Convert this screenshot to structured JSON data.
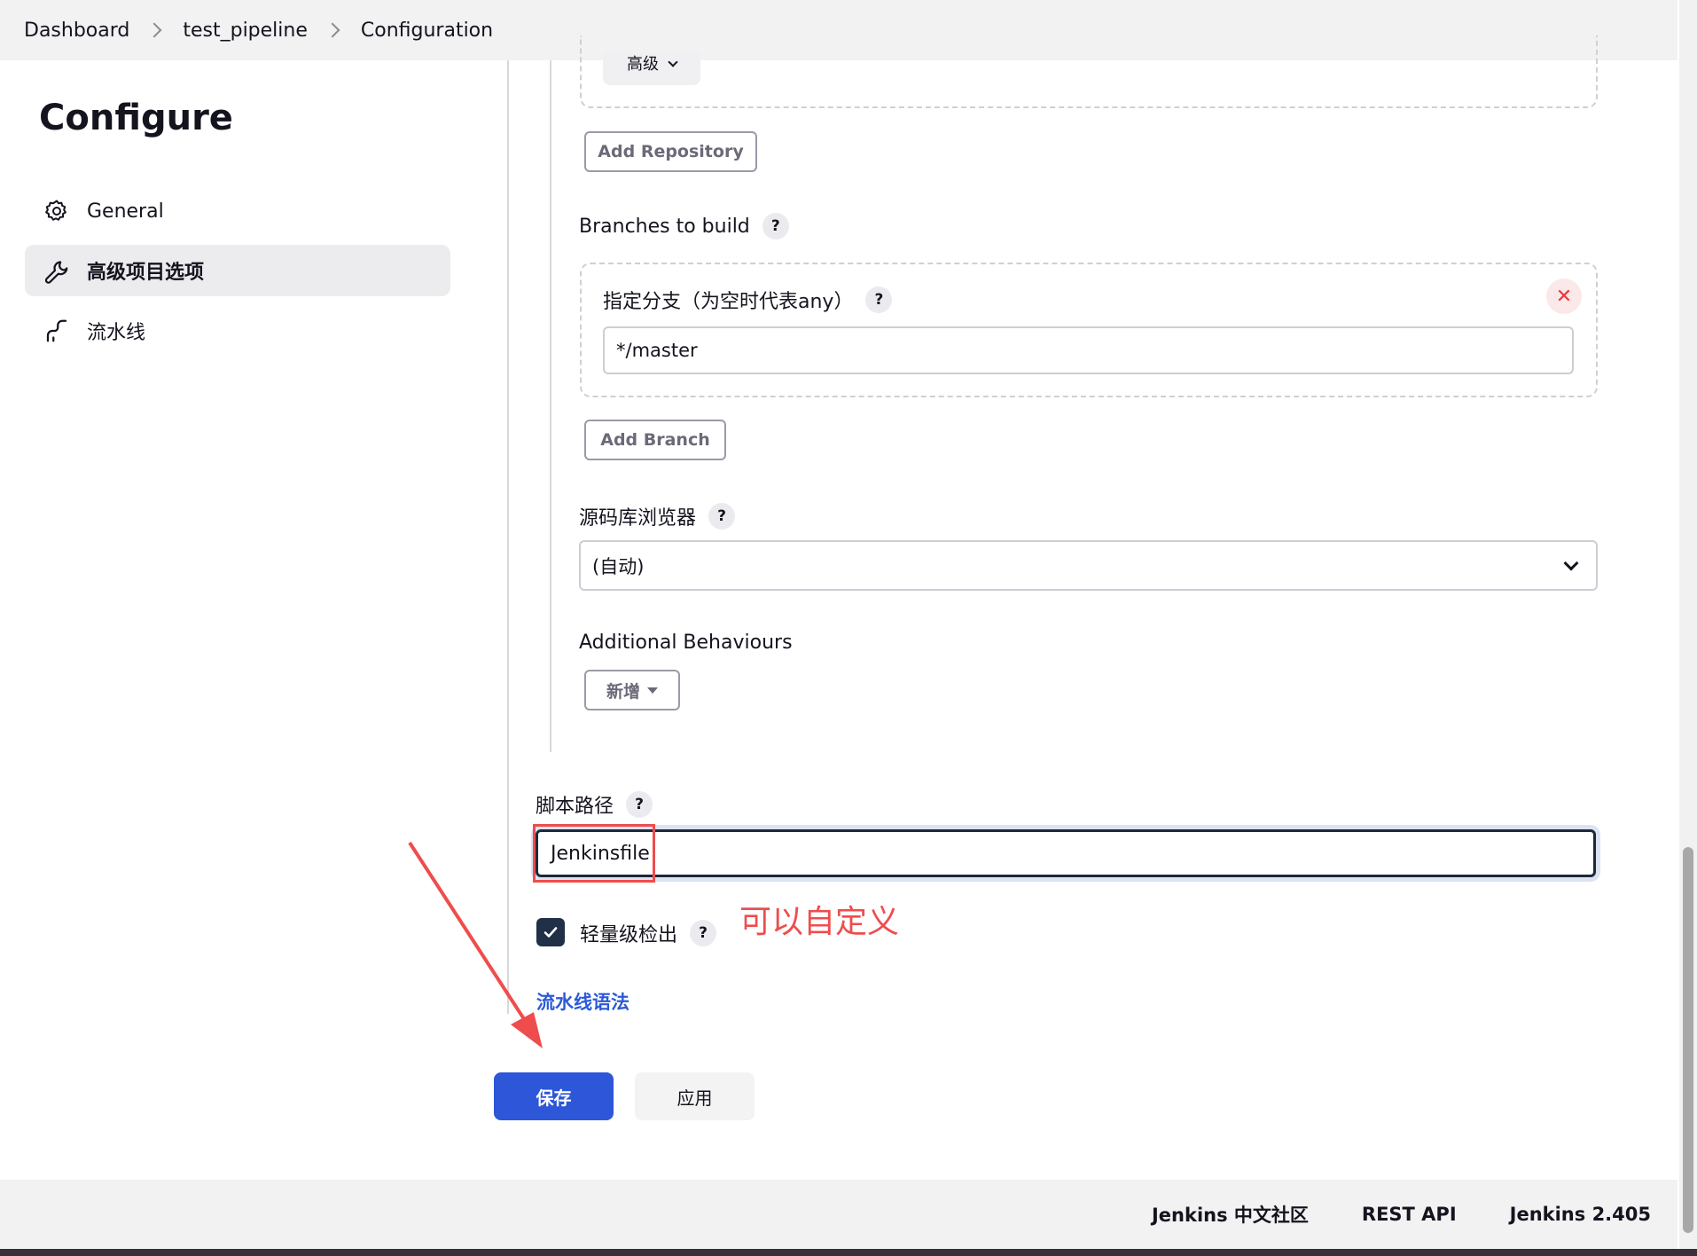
{
  "breadcrumb": {
    "items": [
      "Dashboard",
      "test_pipeline",
      "Configuration"
    ]
  },
  "sidebar": {
    "title": "Configure",
    "items": [
      {
        "label": "General",
        "icon": "gear-icon"
      },
      {
        "label": "高级项目选项",
        "icon": "wrench-icon",
        "active": true
      },
      {
        "label": "流水线",
        "icon": "pipeline-icon"
      }
    ]
  },
  "main": {
    "partial_dropdown_label": "高级",
    "add_repository_label": "Add Repository",
    "branches_label": "Branches to build",
    "branch_specifier_label": "指定分支（为空时代表any）",
    "branch_value": "*/master",
    "add_branch_label": "Add Branch",
    "repo_browser_label": "源码库浏览器",
    "repo_browser_value": "(自动)",
    "additional_behaviours_label": "Additional Behaviours",
    "add_new_label": "新增",
    "script_path_label": "脚本路径",
    "script_path_value": "Jenkinsfile",
    "annotation_text": "可以自定义",
    "lightweight_checkout_label": "轻量级检出",
    "lightweight_checkout_checked": true,
    "pipeline_syntax_link": "流水线语法",
    "help_glyph": "?"
  },
  "actions": {
    "save_label": "保存",
    "apply_label": "应用"
  },
  "footer": {
    "links": [
      "Jenkins 中文社区",
      "REST API",
      "Jenkins 2.405"
    ]
  },
  "colors": {
    "primary": "#2d56d8",
    "annotation": "#ef4d4d",
    "link": "#2c5ad6",
    "checkbox": "#1f3047"
  }
}
